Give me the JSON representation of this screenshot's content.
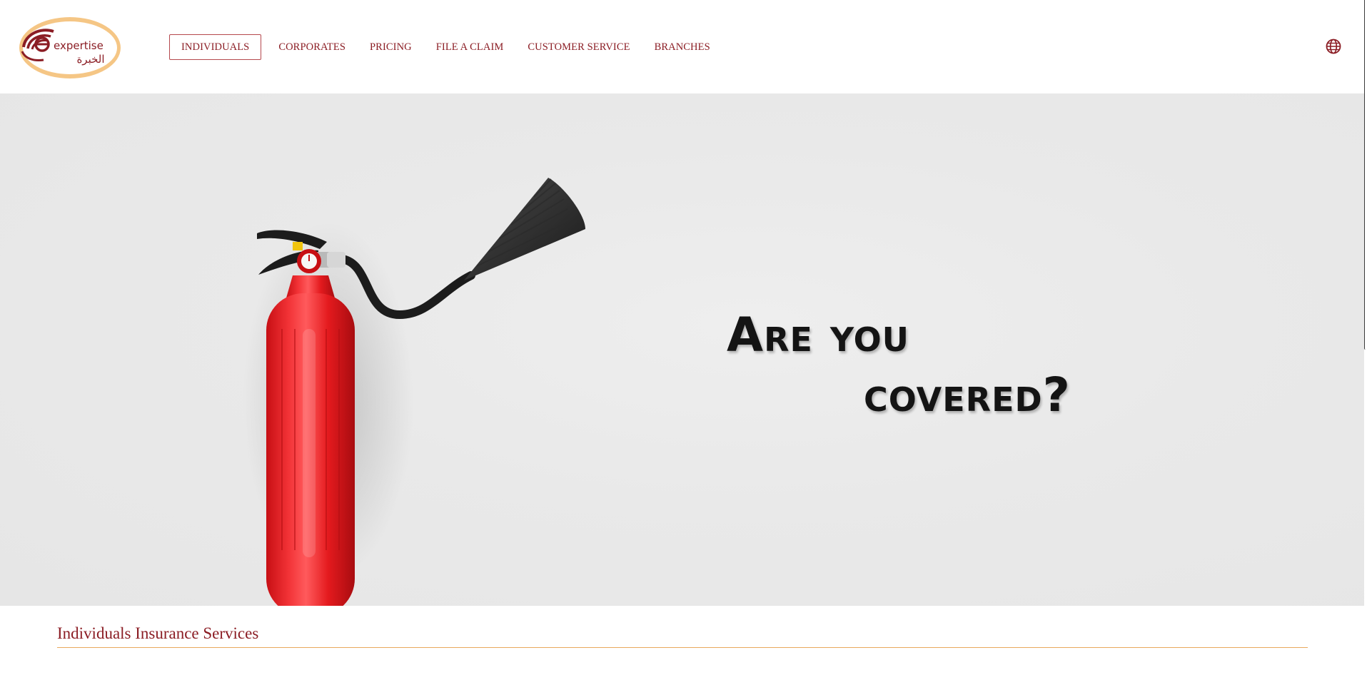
{
  "brand": {
    "logo_text_en": "expertise",
    "logo_text_ar": "الخبرة",
    "colors": {
      "primary": "#8b1d24",
      "accent": "#f5c27a",
      "divider": "#e8a95c"
    }
  },
  "nav": {
    "items": [
      {
        "label": "INDIVIDUALS",
        "active": true
      },
      {
        "label": "CORPORATES",
        "active": false
      },
      {
        "label": "PRICING",
        "active": false
      },
      {
        "label": "FILE A CLAIM",
        "active": false
      },
      {
        "label": "CUSTOMER SERVICE",
        "active": false
      },
      {
        "label": "BRANCHES",
        "active": false
      }
    ],
    "language_icon": "globe-icon"
  },
  "hero": {
    "line1": "Are you",
    "line2": "covered?",
    "image": "fire-extinguisher"
  },
  "section": {
    "title": "Individuals Insurance Services"
  }
}
